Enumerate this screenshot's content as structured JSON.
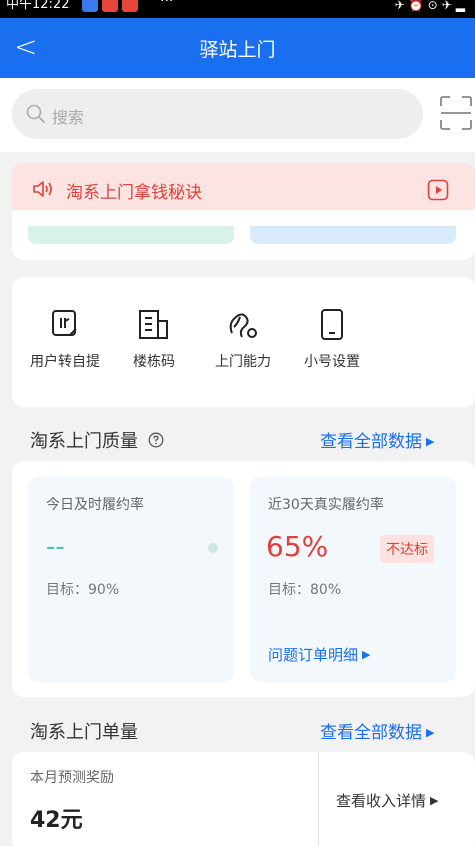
{
  "status_bar": {
    "time": "中午12:22",
    "more": "···"
  },
  "nav": {
    "title": "驿站上门"
  },
  "search": {
    "placeholder": "搜索"
  },
  "notice": {
    "text": "淘系上门拿钱秘诀"
  },
  "tools": [
    {
      "label": "用户转自提"
    },
    {
      "label": "楼栋码"
    },
    {
      "label": "上门能力"
    },
    {
      "label": "小号设置"
    }
  ],
  "quality": {
    "title": "淘系上门质量",
    "link": "查看全部数据",
    "today": {
      "label": "今日及时履约率",
      "value": "--",
      "target": "目标：90%"
    },
    "month": {
      "label": "近30天真实履约率",
      "value": "65%",
      "badge": "不达标",
      "target": "目标：80%",
      "detail_link": "问题订单明细"
    }
  },
  "volume": {
    "title": "淘系上门单量",
    "link": "查看全部数据",
    "reward_label": "本月预测奖励",
    "reward_value": "42元",
    "income_link": "查看收入详情"
  },
  "colors": {
    "primary": "#1a6ef0",
    "alert": "#e0403a",
    "teal": "#3ec8a8"
  }
}
